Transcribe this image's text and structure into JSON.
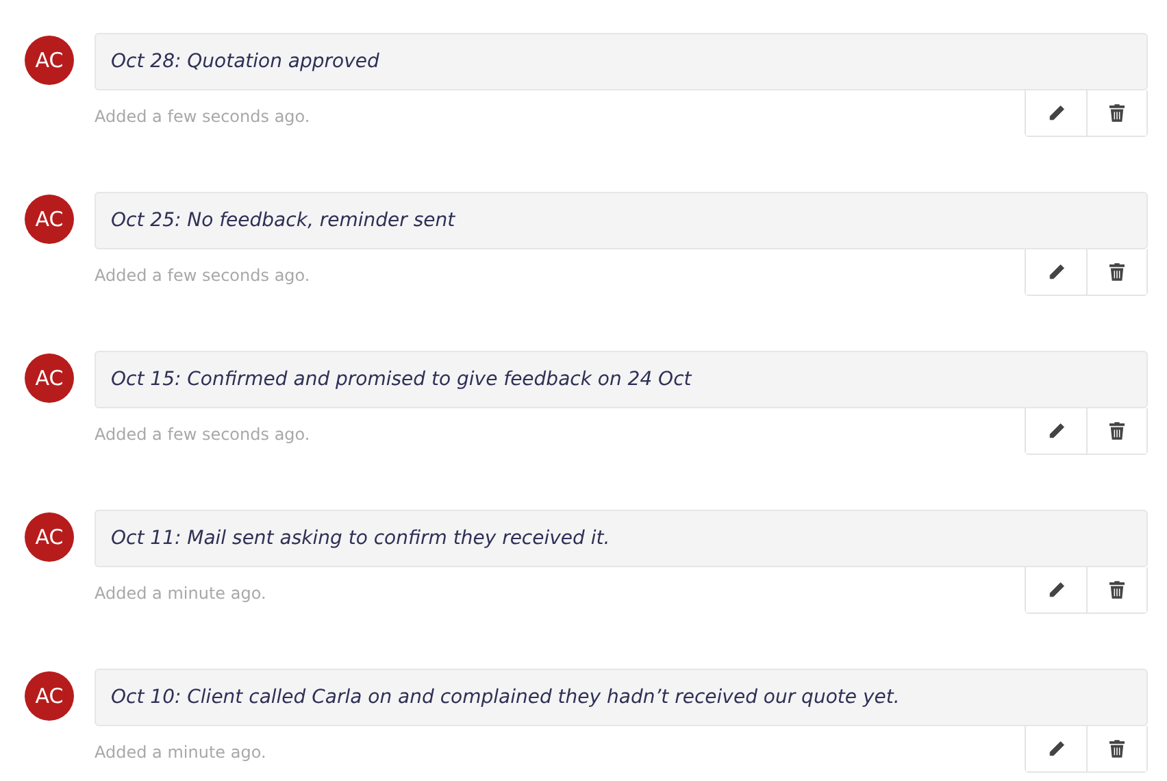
{
  "notes": [
    {
      "avatar": "AC",
      "text": "Oct 28: Quotation approved",
      "added": "Added a few seconds ago."
    },
    {
      "avatar": "AC",
      "text": "Oct 25: No feedback, reminder sent",
      "added": "Added a few seconds ago."
    },
    {
      "avatar": "AC",
      "text": "Oct 15: Confirmed and promised to give feedback on 24 Oct",
      "added": "Added a few seconds ago."
    },
    {
      "avatar": "AC",
      "text": "Oct 11: Mail sent asking to confirm they received it.",
      "added": "Added a minute ago."
    },
    {
      "avatar": "AC",
      "text": "Oct 10: Client called Carla on and complained they hadn’t received our quote yet.",
      "added": "Added a minute ago."
    }
  ]
}
